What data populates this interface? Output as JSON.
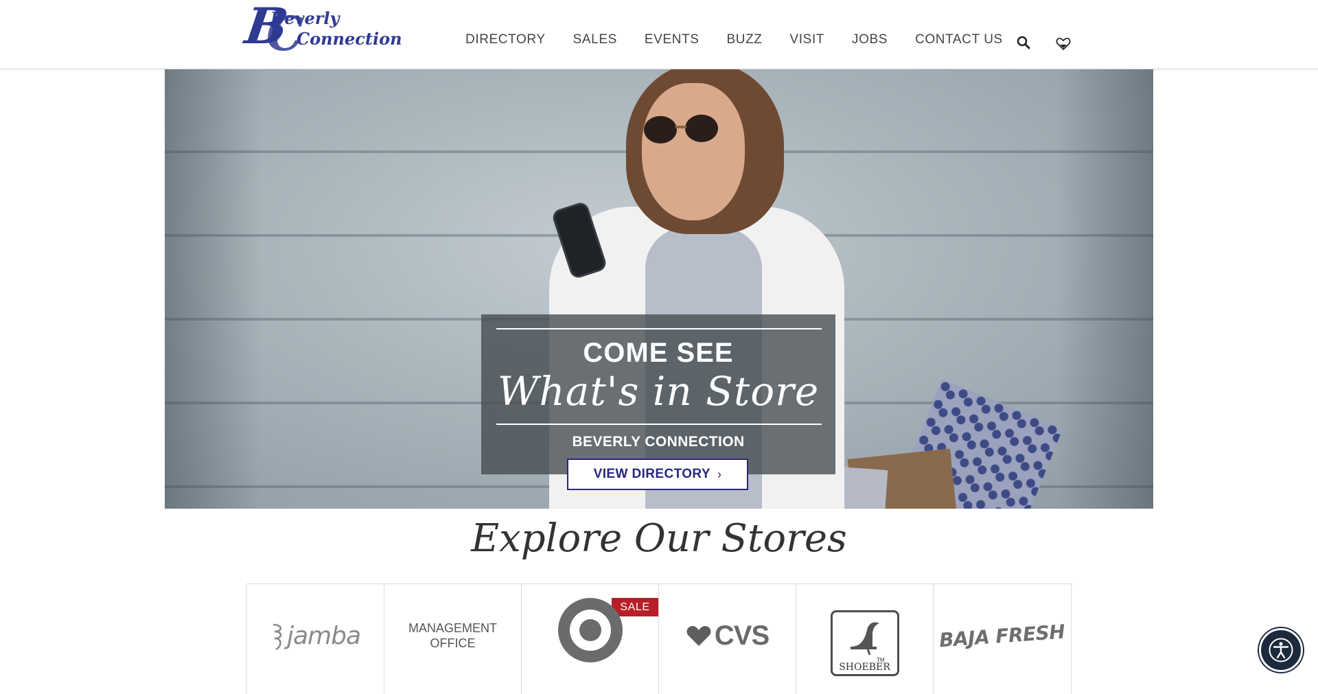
{
  "brand": {
    "logo_text_line1": "Beverly",
    "logo_text_line2": "Connection",
    "logo_initials": "BC",
    "accent_color": "#29277e",
    "logo_color": "#2e3a92",
    "sale_color": "#b71e28"
  },
  "nav": {
    "items": [
      {
        "label": "DIRECTORY"
      },
      {
        "label": "SALES"
      },
      {
        "label": "EVENTS"
      },
      {
        "label": "BUZZ"
      },
      {
        "label": "VISIT"
      },
      {
        "label": "JOBS"
      },
      {
        "label": "CONTACT US"
      }
    ],
    "icons": [
      "search-icon",
      "heart-icon"
    ]
  },
  "hero": {
    "line1": "COME SEE",
    "line2": "What's in Store",
    "subtitle": "BEVERLY CONNECTION",
    "cta_label": "VIEW DIRECTORY",
    "cta_chevron": "›"
  },
  "stores_section": {
    "title": "Explore Our Stores",
    "stores": [
      {
        "name": "jamba",
        "sale": false
      },
      {
        "name": "MANAGEMENT OFFICE",
        "line1": "MANAGEMENT",
        "line2": "OFFICE",
        "sale": false
      },
      {
        "name": "Target",
        "sale": true,
        "badge": "SALE"
      },
      {
        "name": "CVS",
        "sale": false
      },
      {
        "name": "SHOEBER",
        "trademark": "TM",
        "sale": false
      },
      {
        "name": "BAJA FRESH",
        "sale": false
      }
    ]
  },
  "accessibility": {
    "icon": "accessibility-icon"
  }
}
